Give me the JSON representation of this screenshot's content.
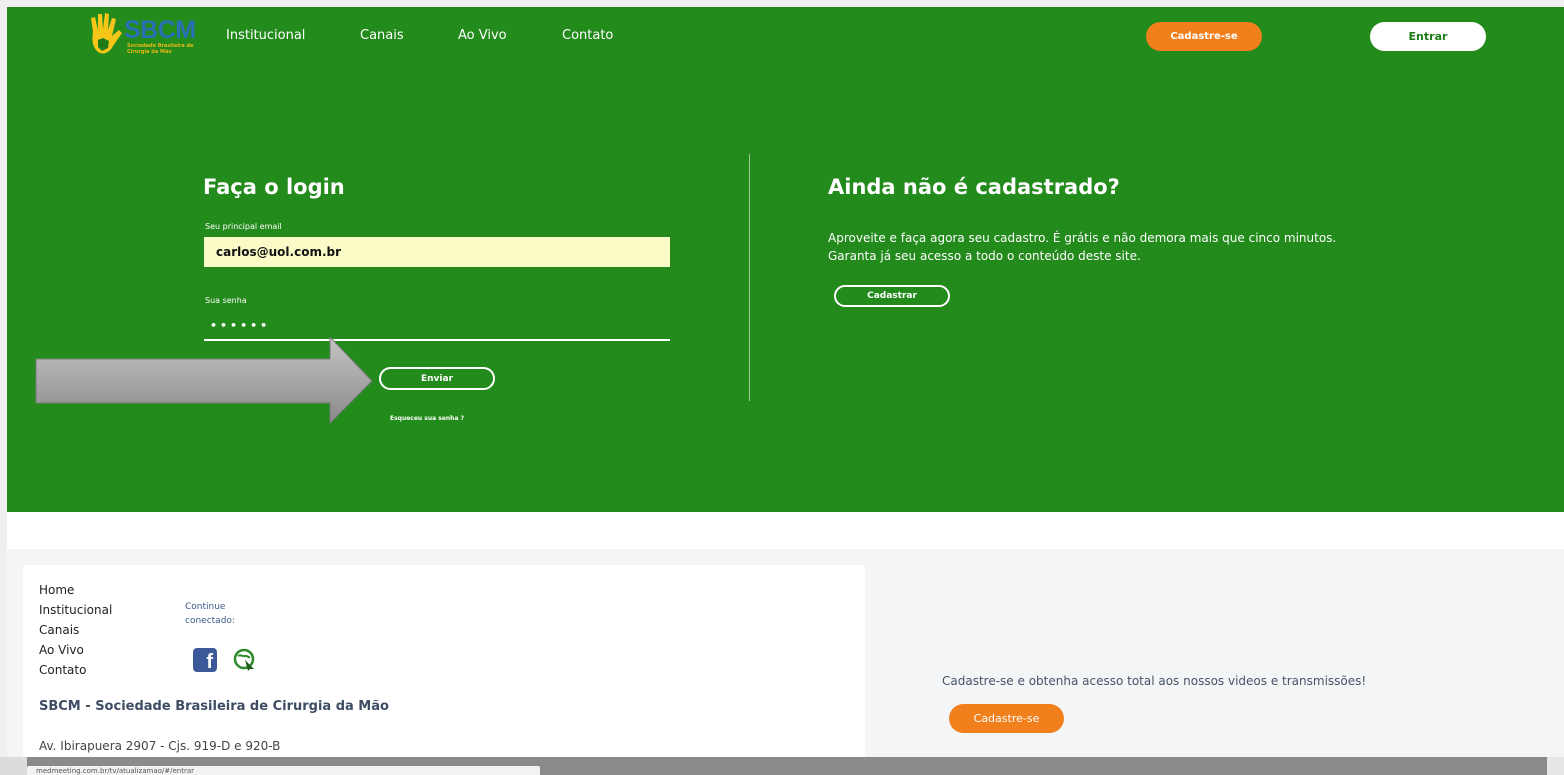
{
  "logo": {
    "text": "SBCM",
    "subtitle": "Sociedade Brasileira de Cirurgia da Mão"
  },
  "nav": {
    "links": [
      "Institucional",
      "Canais",
      "Ao Vivo",
      "Contato"
    ],
    "cadastre_label": "Cadastre-se",
    "entrar_label": "Entrar"
  },
  "login": {
    "title": "Faça o login",
    "email_label": "Seu principal email",
    "email_value": "carlos@uol.com.br",
    "password_label": "Sua senha",
    "password_value": "••••••",
    "submit_label": "Enviar",
    "forgot_label": "Esqueceu sua senha ?"
  },
  "register": {
    "title": "Ainda não é cadastrado?",
    "text": "Aproveite e faça agora seu cadastro. É grátis e não demora mais que cinco minutos. Garanta já seu acesso a todo o conteúdo deste site.",
    "button_label": "Cadastrar"
  },
  "footer": {
    "links": [
      "Home",
      "Institucional",
      "Canais",
      "Ao Vivo",
      "Contato"
    ],
    "continue_text": "Continue conectado:",
    "org_name": "SBCM - Sociedade Brasileira de Cirurgia da Mão",
    "address": "Av. Ibirapuera 2907 - Cjs. 919-D e 920-B",
    "promo_text": "Cadastre-se e obtenha acesso total aos nossos videos e transmissões!",
    "cadastre_label": "Cadastre-se"
  },
  "status_bar": {
    "url": "medmeeting.com.br/tv/atualizamao/#/entrar"
  },
  "colors": {
    "green": "#238a1c",
    "orange": "#f07f1c",
    "input_bg": "#fafbc6"
  }
}
